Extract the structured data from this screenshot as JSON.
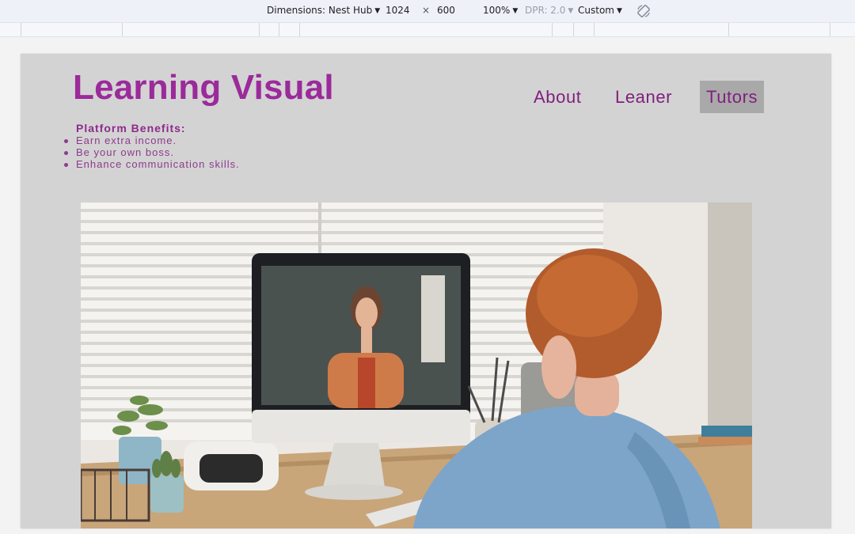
{
  "devtools": {
    "dimensions_label": "Dimensions: Nest Hub",
    "width": "1024",
    "times": "×",
    "height": "600",
    "zoom": "100%",
    "dpr": "DPR: 2.0",
    "throttle": "Custom"
  },
  "site": {
    "title": "Learning Visual",
    "nav": [
      {
        "label": "About",
        "active": false
      },
      {
        "label": "Leaner",
        "active": false
      },
      {
        "label": "Tutors",
        "active": true
      }
    ],
    "benefits": {
      "heading": "Platform Benefits:",
      "items": [
        "Earn extra income.",
        "Be your own boss.",
        "Enhance communication skills."
      ]
    }
  },
  "colors": {
    "title": "#9b2a9b",
    "nav_text": "#7f1f7f",
    "nav_active_bg": "#a9a9a9",
    "page_bg": "#d3d3d3"
  },
  "hero_image": {
    "icon": "photo-child-on-video-call-with-tutor"
  }
}
